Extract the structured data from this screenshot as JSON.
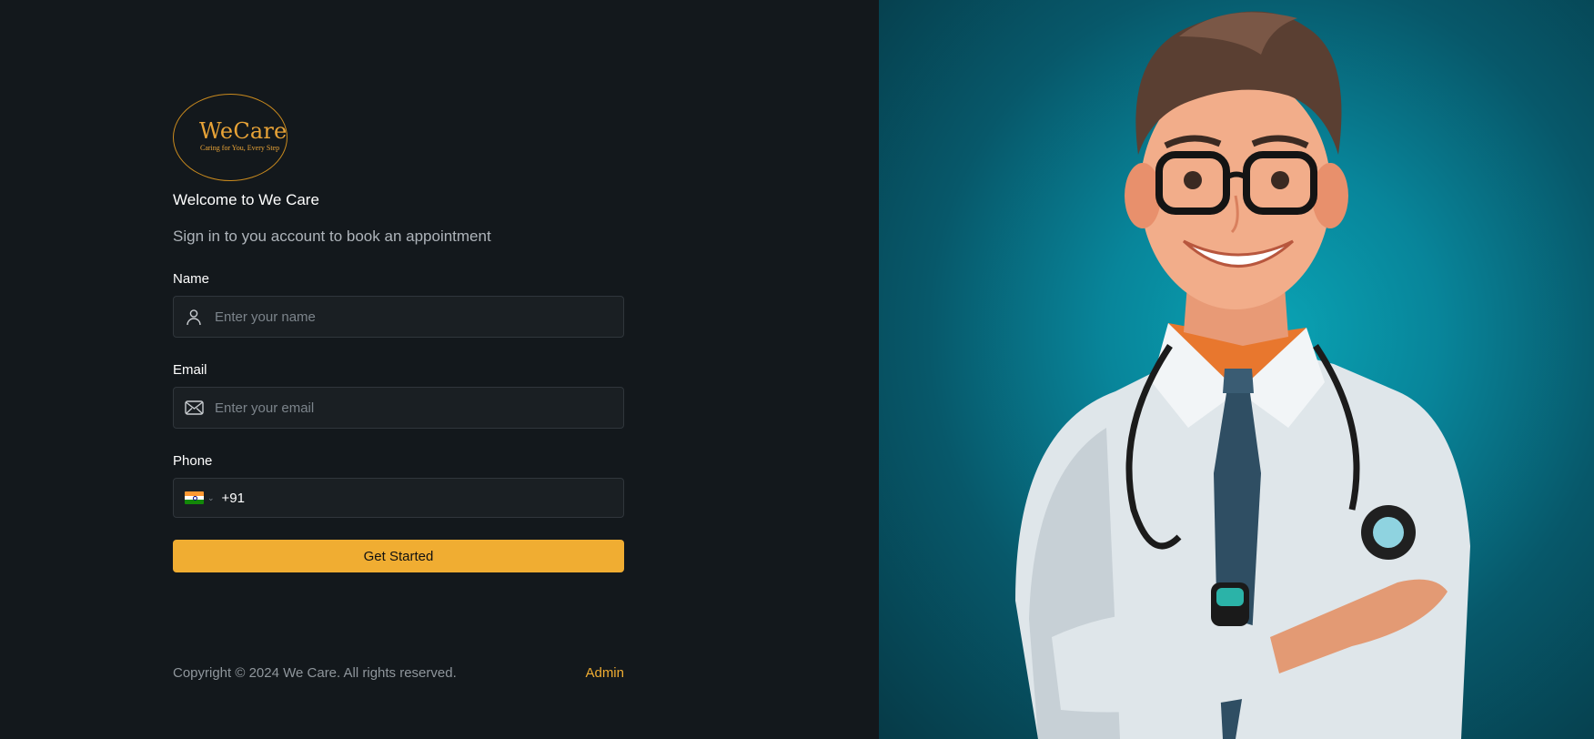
{
  "logo": {
    "title": "WeCare",
    "tagline": "Caring for You, Every Step"
  },
  "welcome": "Welcome to We Care",
  "subtitle": "Sign in to you account to book an appointment",
  "form": {
    "name": {
      "label": "Name",
      "placeholder": "Enter your name",
      "icon": "user-icon"
    },
    "email": {
      "label": "Email",
      "placeholder": "Enter your email",
      "icon": "mail-icon"
    },
    "phone": {
      "label": "Phone",
      "country_flag": "india-flag-icon",
      "dial_code": "+91"
    },
    "submit_label": "Get Started"
  },
  "footer": {
    "copyright": "Copyright © 2024 We Care. All rights reserved.",
    "admin_link": "Admin"
  },
  "colors": {
    "background": "#13181c",
    "accent": "#f0ad32",
    "input_bg": "#1a1f23",
    "hero_bg": "#0aa3b4"
  },
  "hero": {
    "image": "cartoon-doctor-illustration"
  }
}
